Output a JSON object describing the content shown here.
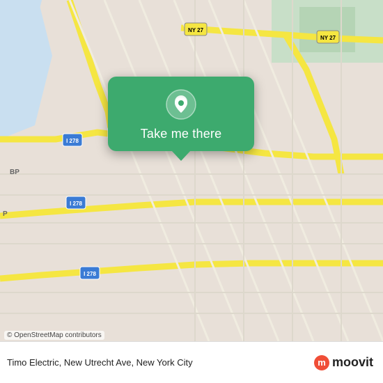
{
  "map": {
    "alt": "Street map of New Utrecht Ave area, Brooklyn, New York City"
  },
  "popup": {
    "label": "Take me there",
    "pin_icon": "location-pin-icon"
  },
  "bottom_bar": {
    "address": "Timo Electric, New Utrecht Ave, New York City",
    "osm_credit": "© OpenStreetMap contributors",
    "moovit_logo_letter": "m",
    "moovit_logo_word": "moovit"
  }
}
